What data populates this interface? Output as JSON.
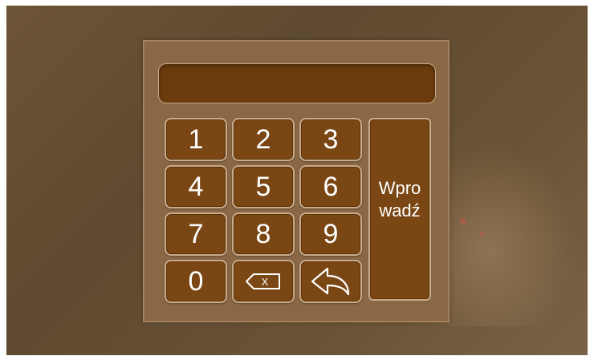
{
  "keypad": {
    "display_value": "",
    "digits": [
      "1",
      "2",
      "3",
      "4",
      "5",
      "6",
      "7",
      "8",
      "9",
      "0"
    ],
    "enter": {
      "line1": "Wpro",
      "line2": "wadź"
    },
    "icons": {
      "backspace": "backspace-icon",
      "back": "back-arrow-icon"
    },
    "backspace_glyph": "X"
  },
  "colors": {
    "panel": "#8a6846",
    "key": "#7a4714",
    "display": "#6b3b0c",
    "key_border": "#c9ab8a"
  }
}
